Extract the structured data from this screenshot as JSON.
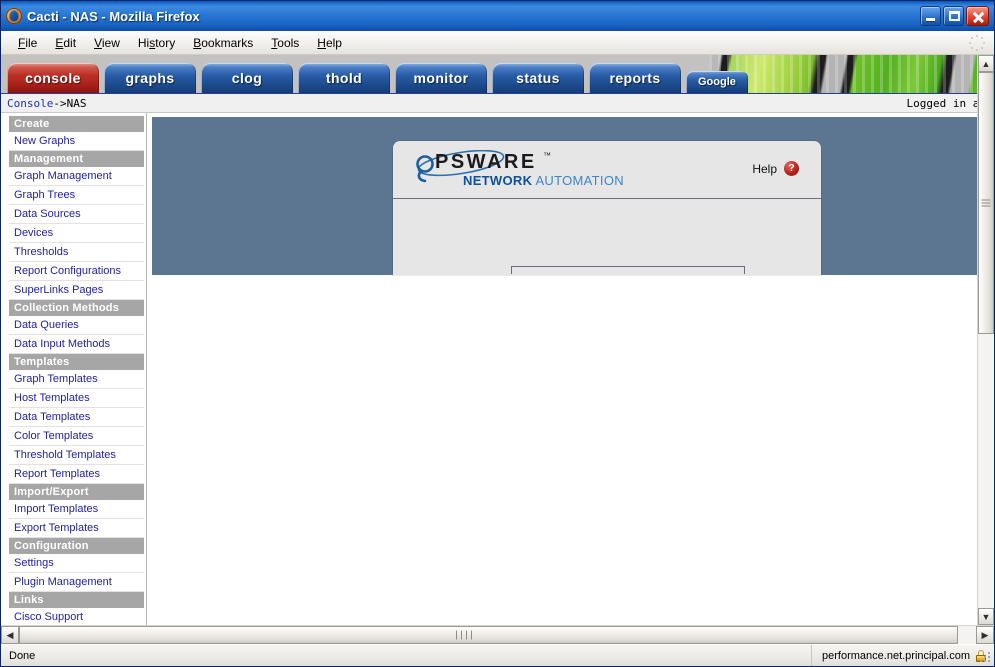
{
  "window": {
    "title": "Cacti - NAS - Mozilla Firefox",
    "app_icon": "firefox-icon",
    "minimize_label": "Minimize",
    "maximize_label": "Maximize",
    "close_label": "Close"
  },
  "menubar": {
    "items": [
      {
        "label": "File",
        "accel": "F"
      },
      {
        "label": "Edit",
        "accel": "E"
      },
      {
        "label": "View",
        "accel": "V"
      },
      {
        "label": "History",
        "accel": "s"
      },
      {
        "label": "Bookmarks",
        "accel": "B"
      },
      {
        "label": "Tools",
        "accel": "T"
      },
      {
        "label": "Help",
        "accel": "H"
      }
    ],
    "throbber": "loading-throbber-icon"
  },
  "tabstrip": {
    "tabs": [
      {
        "label": "console",
        "active": true
      },
      {
        "label": "graphs",
        "active": false
      },
      {
        "label": "clog",
        "active": false
      },
      {
        "label": "thold",
        "active": false
      },
      {
        "label": "monitor",
        "active": false
      },
      {
        "label": "status",
        "active": false
      },
      {
        "label": "reports",
        "active": false
      },
      {
        "label": "Google",
        "active": false,
        "small": true
      }
    ],
    "active_color": "#bb3126",
    "inactive_color": "#2a5ea8",
    "banner": "green-stripes-banner"
  },
  "breadcrumb": {
    "root": "Console",
    "separator": " -> ",
    "current": "NAS",
    "logged_in": "Logged in as"
  },
  "sidebar": {
    "groups": [
      {
        "header": "Create",
        "items": [
          "New Graphs"
        ]
      },
      {
        "header": "Management",
        "items": [
          "Graph Management",
          "Graph Trees",
          "Data Sources",
          "Devices",
          "Thresholds",
          "Report Configurations",
          "SuperLinks Pages"
        ]
      },
      {
        "header": "Collection Methods",
        "items": [
          "Data Queries",
          "Data Input Methods"
        ]
      },
      {
        "header": "Templates",
        "items": [
          "Graph Templates",
          "Host Templates",
          "Data Templates",
          "Color Templates",
          "Threshold Templates",
          "Report Templates"
        ]
      },
      {
        "header": "Import/Export",
        "items": [
          "Import Templates",
          "Export Templates"
        ]
      },
      {
        "header": "Configuration",
        "items": [
          "Settings",
          "Plugin Management"
        ]
      },
      {
        "header": "Links",
        "items": [
          "Cisco Support"
        ]
      }
    ]
  },
  "content": {
    "panel_color": "#5c7591",
    "logo": {
      "mark": "opsware-o-swoosh-icon",
      "wordmark": "PSWARE",
      "trademark": "™",
      "sub_bold": "NETWORK",
      "sub_light": " AUTOMATION"
    },
    "help": {
      "label": "Help",
      "icon": "help-question-icon",
      "glyph": "?"
    }
  },
  "scrollbars": {
    "vertical": {
      "up_arrow": "▲",
      "down_arrow": "▼"
    },
    "horizontal": {
      "left_arrow": "◀",
      "right_arrow": "▶"
    }
  },
  "statusbar": {
    "status": "Done",
    "security_host": "performance.net.principal.com",
    "lock_icon": "padlock-icon"
  }
}
